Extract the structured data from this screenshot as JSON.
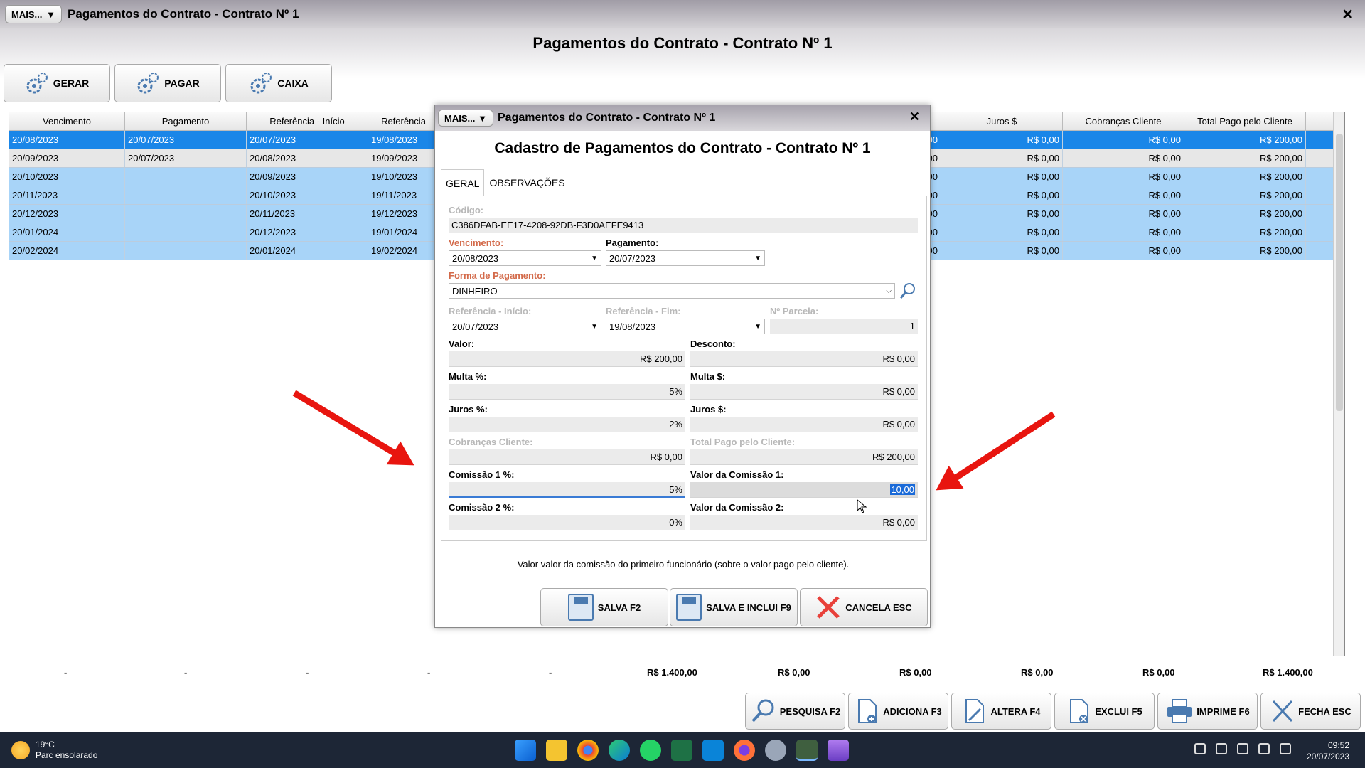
{
  "window": {
    "mais_label": "MAIS...",
    "title": "Pagamentos do Contrato - Contrato Nº 1",
    "heading": "Pagamentos do Contrato - Contrato Nº 1",
    "close": "✕"
  },
  "top_buttons": [
    {
      "label": "GERAR"
    },
    {
      "label": "PAGAR"
    },
    {
      "label": "CAIXA"
    }
  ],
  "grid": {
    "columns": [
      "Vencimento",
      "Pagamento",
      "Referência - Início",
      "Referência",
      "Juros $",
      "Cobranças Cliente",
      "Total Pago pelo Cliente"
    ],
    "rows": [
      {
        "venc": "20/08/2023",
        "pag": "20/07/2023",
        "ref_ini": "20/07/2023",
        "ref_fim": "19/08/2023",
        "c1": "R$ 0,00",
        "juros": "R$ 0,00",
        "cob": "R$ 0,00",
        "total": "R$ 200,00"
      },
      {
        "venc": "20/09/2023",
        "pag": "20/07/2023",
        "ref_ini": "20/08/2023",
        "ref_fim": "19/09/2023",
        "c1": "R$ 0,00",
        "juros": "R$ 0,00",
        "cob": "R$ 0,00",
        "total": "R$ 200,00"
      },
      {
        "venc": "20/10/2023",
        "pag": "",
        "ref_ini": "20/09/2023",
        "ref_fim": "19/10/2023",
        "c1": "R$ 0,00",
        "juros": "R$ 0,00",
        "cob": "R$ 0,00",
        "total": "R$ 200,00"
      },
      {
        "venc": "20/11/2023",
        "pag": "",
        "ref_ini": "20/10/2023",
        "ref_fim": "19/11/2023",
        "c1": "R$ 0,00",
        "juros": "R$ 0,00",
        "cob": "R$ 0,00",
        "total": "R$ 200,00"
      },
      {
        "venc": "20/12/2023",
        "pag": "",
        "ref_ini": "20/11/2023",
        "ref_fim": "19/12/2023",
        "c1": "R$ 0,00",
        "juros": "R$ 0,00",
        "cob": "R$ 0,00",
        "total": "R$ 200,00"
      },
      {
        "venc": "20/01/2024",
        "pag": "",
        "ref_ini": "20/12/2023",
        "ref_fim": "19/01/2024",
        "c1": "R$ 0,00",
        "juros": "R$ 0,00",
        "cob": "R$ 0,00",
        "total": "R$ 200,00"
      },
      {
        "venc": "20/02/2024",
        "pag": "",
        "ref_ini": "20/01/2024",
        "ref_fim": "19/02/2024",
        "c1": "R$ 0,00",
        "juros": "R$ 0,00",
        "cob": "R$ 0,00",
        "total": "R$ 200,00"
      }
    ]
  },
  "totals": [
    "-",
    "-",
    "-",
    "-",
    "-",
    "R$ 1.400,00",
    "R$ 0,00",
    "R$ 0,00",
    "R$ 0,00",
    "R$ 0,00",
    "R$ 1.400,00"
  ],
  "bottom_buttons": [
    {
      "label": "PESQUISA F2"
    },
    {
      "label": "ADICIONA F3"
    },
    {
      "label": "ALTERA F4"
    },
    {
      "label": "EXCLUI F5"
    },
    {
      "label": "IMPRIME F6"
    },
    {
      "label": "FECHA ESC"
    }
  ],
  "modal": {
    "mais_label": "MAIS...",
    "title": "Pagamentos do Contrato - Contrato Nº 1",
    "heading": "Cadastro de Pagamentos do Contrato - Contrato Nº 1",
    "close": "✕",
    "tabs": [
      "GERAL",
      "OBSERVAÇÕES"
    ],
    "fields": {
      "codigo_label": "Código:",
      "codigo": "C386DFAB-EE17-4208-92DB-F3D0AEFE9413",
      "vencimento_label": "Vencimento:",
      "vencimento": "20/08/2023",
      "pagamento_label": "Pagamento:",
      "pagamento": "20/07/2023",
      "forma_label": "Forma de Pagamento:",
      "forma": "DINHEIRO",
      "ref_ini_label": "Referência - Início:",
      "ref_ini": "20/07/2023",
      "ref_fim_label": "Referência - Fim:",
      "ref_fim": "19/08/2023",
      "parcela_label": "Nº Parcela:",
      "parcela": "1",
      "valor_label": "Valor:",
      "valor": "R$ 200,00",
      "desconto_label": "Desconto:",
      "desconto": "R$ 0,00",
      "multa_pct_label": "Multa %:",
      "multa_pct": "5%",
      "multa_val_label": "Multa $:",
      "multa_val": "R$ 0,00",
      "juros_pct_label": "Juros %:",
      "juros_pct": "2%",
      "juros_val_label": "Juros $:",
      "juros_val": "R$ 0,00",
      "cob_label": "Cobranças Cliente:",
      "cob": "R$ 0,00",
      "total_label": "Total Pago pelo Cliente:",
      "total": "R$ 200,00",
      "com1_pct_label": "Comissão 1 %:",
      "com1_pct": "5%",
      "com1_val_label": "Valor da Comissão 1:",
      "com1_val": "10,00",
      "com2_pct_label": "Comissão 2 %:",
      "com2_pct": "0%",
      "com2_val_label": "Valor da Comissão 2:",
      "com2_val": "R$ 0,00"
    },
    "hint": "Valor valor da comissão do primeiro funcionário (sobre o valor pago pelo cliente).",
    "buttons": [
      {
        "label": "SALVA F2"
      },
      {
        "label": "SALVA E INCLUI F9"
      },
      {
        "label": "CANCELA ESC"
      }
    ]
  },
  "taskbar": {
    "temp": "19°C",
    "weather": "Parc ensolarado",
    "time": "09:52",
    "date": "20/07/2023"
  },
  "colors": {
    "selection": "#1a86e8",
    "row_bg": "#a8d4f8",
    "required_label": "#d36a4a",
    "arrow": "#e8150f"
  }
}
